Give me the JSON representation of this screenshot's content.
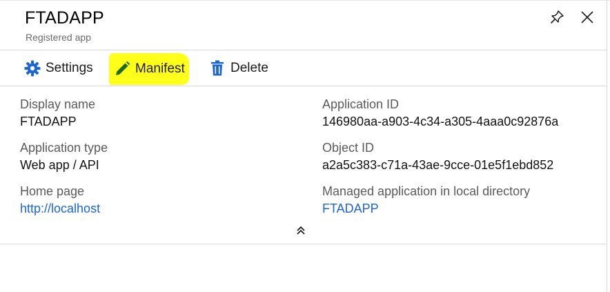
{
  "header": {
    "title": "FTADAPP",
    "subtitle": "Registered app",
    "pin_icon": "pin-icon",
    "close_icon": "close-icon"
  },
  "toolbar": {
    "settings_label": "Settings",
    "manifest_label": "Manifest",
    "delete_label": "Delete",
    "settings_icon": "gear-icon",
    "manifest_icon": "pencil-icon",
    "delete_icon": "trash-icon",
    "highlight_color": "#ffff1a",
    "icon_color": "#1a64d6"
  },
  "properties": {
    "display_name": {
      "label": "Display name",
      "value": "FTADAPP"
    },
    "application_type": {
      "label": "Application type",
      "value": "Web app / API"
    },
    "home_page": {
      "label": "Home page",
      "value": "http://localhost"
    },
    "application_id": {
      "label": "Application ID",
      "value": "146980aa-a903-4c34-a305-4aaa0c92876a"
    },
    "object_id": {
      "label": "Object ID",
      "value": "a2a5c383-c71a-43ae-9cce-01e5f1ebd852"
    },
    "managed_application": {
      "label": "Managed application in local directory",
      "value": "FTADAPP"
    }
  },
  "colors": {
    "link": "#1a64d6",
    "label": "#5a5a5a",
    "divider": "#d6d6d6"
  },
  "collapse_icon": "double-chevron-up-icon"
}
